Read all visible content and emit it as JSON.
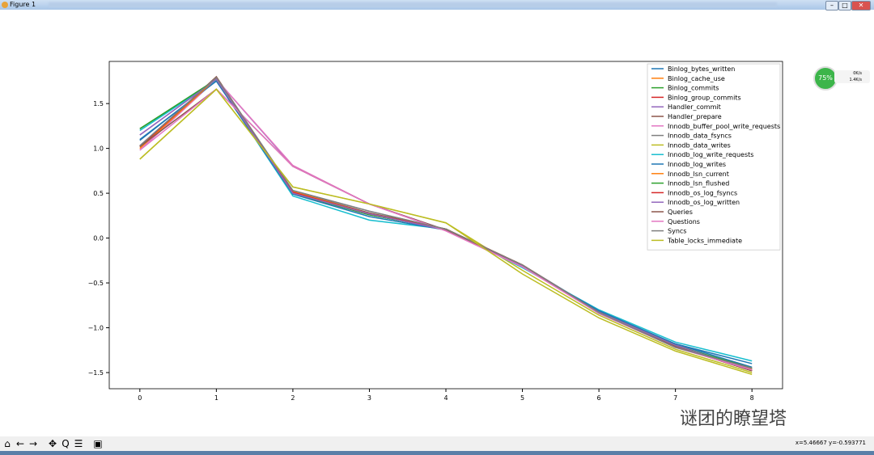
{
  "window": {
    "title": "Figure 1",
    "minimize": "–",
    "maximize": "□",
    "close": "✕"
  },
  "toolbar": {
    "icons": [
      "home-icon",
      "back-icon",
      "forward-icon",
      "pan-icon",
      "zoom-icon",
      "configure-subplots-icon",
      "save-icon"
    ],
    "glyphs": [
      "⌂",
      "←",
      "→",
      "✥",
      "Q",
      "☰",
      "▣"
    ],
    "coords": "x=5.46667     y=-0.593771"
  },
  "widget": {
    "percent": "75%",
    "up": "0K/s",
    "down": "1.4K/s"
  },
  "watermark": "谜团的瞭望塔",
  "chart_data": {
    "type": "line",
    "title": "",
    "xlabel": "",
    "ylabel": "",
    "xlim": [
      -0.4,
      8.4
    ],
    "ylim": [
      -1.68,
      1.97
    ],
    "xticks": [
      0,
      1,
      2,
      3,
      4,
      5,
      6,
      7,
      8
    ],
    "yticks": [
      -1.5,
      -1.0,
      -0.5,
      0.0,
      0.5,
      1.0,
      1.5
    ],
    "ytick_labels": [
      "−1.5",
      "−1.0",
      "−0.5",
      "0.0",
      "0.5",
      "1.0",
      "1.5"
    ],
    "legend_position": "top-right",
    "x": [
      0,
      1,
      2,
      3,
      4,
      5,
      6,
      7,
      8
    ],
    "series": [
      {
        "name": "Binlog_bytes_written",
        "color": "#1f77b4",
        "values": [
          1.09,
          1.76,
          0.5,
          0.26,
          0.1,
          -0.3,
          -0.82,
          -1.18,
          -1.44
        ]
      },
      {
        "name": "Binlog_cache_use",
        "color": "#ff7f0e",
        "values": [
          1.0,
          1.78,
          0.52,
          0.27,
          0.1,
          -0.3,
          -0.83,
          -1.2,
          -1.46
        ]
      },
      {
        "name": "Binlog_commits",
        "color": "#2ca02c",
        "values": [
          1.22,
          1.76,
          0.5,
          0.26,
          0.1,
          -0.31,
          -0.83,
          -1.2,
          -1.46
        ]
      },
      {
        "name": "Binlog_group_commits",
        "color": "#d62728",
        "values": [
          1.02,
          1.79,
          0.51,
          0.27,
          0.1,
          -0.3,
          -0.83,
          -1.21,
          -1.48
        ]
      },
      {
        "name": "Handler_commit",
        "color": "#9467bd",
        "values": [
          1.15,
          1.77,
          0.8,
          0.38,
          0.09,
          -0.31,
          -0.82,
          -1.19,
          -1.47
        ]
      },
      {
        "name": "Handler_prepare",
        "color": "#8c564b",
        "values": [
          1.02,
          1.8,
          0.52,
          0.28,
          0.1,
          -0.3,
          -0.84,
          -1.21,
          -1.48
        ]
      },
      {
        "name": "Innodb_buffer_pool_write_requests",
        "color": "#e377c2",
        "values": [
          0.98,
          1.77,
          0.81,
          0.38,
          0.08,
          -0.32,
          -0.83,
          -1.2,
          -1.47
        ]
      },
      {
        "name": "Innodb_data_fsyncs",
        "color": "#7f7f7f",
        "values": [
          1.03,
          1.79,
          0.53,
          0.3,
          0.1,
          -0.3,
          -0.83,
          -1.22,
          -1.45
        ]
      },
      {
        "name": "Innodb_data_writes",
        "color": "#bcbd22",
        "values": [
          0.88,
          1.66,
          0.57,
          0.38,
          0.17,
          -0.36,
          -0.86,
          -1.24,
          -1.5
        ]
      },
      {
        "name": "Innodb_log_write_requests",
        "color": "#17becf",
        "values": [
          1.2,
          1.76,
          0.47,
          0.2,
          0.1,
          -0.33,
          -0.8,
          -1.16,
          -1.37
        ]
      },
      {
        "name": "Innodb_log_writes",
        "color": "#1f77b4",
        "values": [
          1.1,
          1.75,
          0.49,
          0.24,
          0.09,
          -0.32,
          -0.81,
          -1.18,
          -1.4
        ]
      },
      {
        "name": "Innodb_lsn_current",
        "color": "#ff7f0e",
        "values": [
          1.0,
          1.78,
          0.52,
          0.27,
          0.1,
          -0.3,
          -0.83,
          -1.2,
          -1.46
        ]
      },
      {
        "name": "Innodb_lsn_flushed",
        "color": "#2ca02c",
        "values": [
          1.22,
          1.77,
          0.5,
          0.26,
          0.1,
          -0.31,
          -0.83,
          -1.2,
          -1.45
        ]
      },
      {
        "name": "Innodb_os_log_fsyncs",
        "color": "#d62728",
        "values": [
          1.02,
          1.79,
          0.51,
          0.27,
          0.1,
          -0.3,
          -0.83,
          -1.21,
          -1.48
        ]
      },
      {
        "name": "Innodb_os_log_written",
        "color": "#9467bd",
        "values": [
          1.15,
          1.77,
          0.5,
          0.27,
          0.09,
          -0.31,
          -0.83,
          -1.2,
          -1.47
        ]
      },
      {
        "name": "Queries",
        "color": "#8c564b",
        "values": [
          1.02,
          1.66,
          0.8,
          0.38,
          0.09,
          -0.3,
          -0.84,
          -1.21,
          -1.48
        ]
      },
      {
        "name": "Questions",
        "color": "#e377c2",
        "values": [
          0.98,
          1.66,
          0.8,
          0.38,
          0.08,
          -0.32,
          -0.84,
          -1.22,
          -1.47
        ]
      },
      {
        "name": "Syncs",
        "color": "#7f7f7f",
        "values": [
          1.03,
          1.79,
          0.53,
          0.3,
          0.1,
          -0.3,
          -0.83,
          -1.22,
          -1.45
        ]
      },
      {
        "name": "Table_locks_immediate",
        "color": "#bcbd22",
        "values": [
          0.88,
          1.66,
          0.57,
          0.38,
          0.17,
          -0.4,
          -0.89,
          -1.26,
          -1.52
        ]
      }
    ]
  }
}
